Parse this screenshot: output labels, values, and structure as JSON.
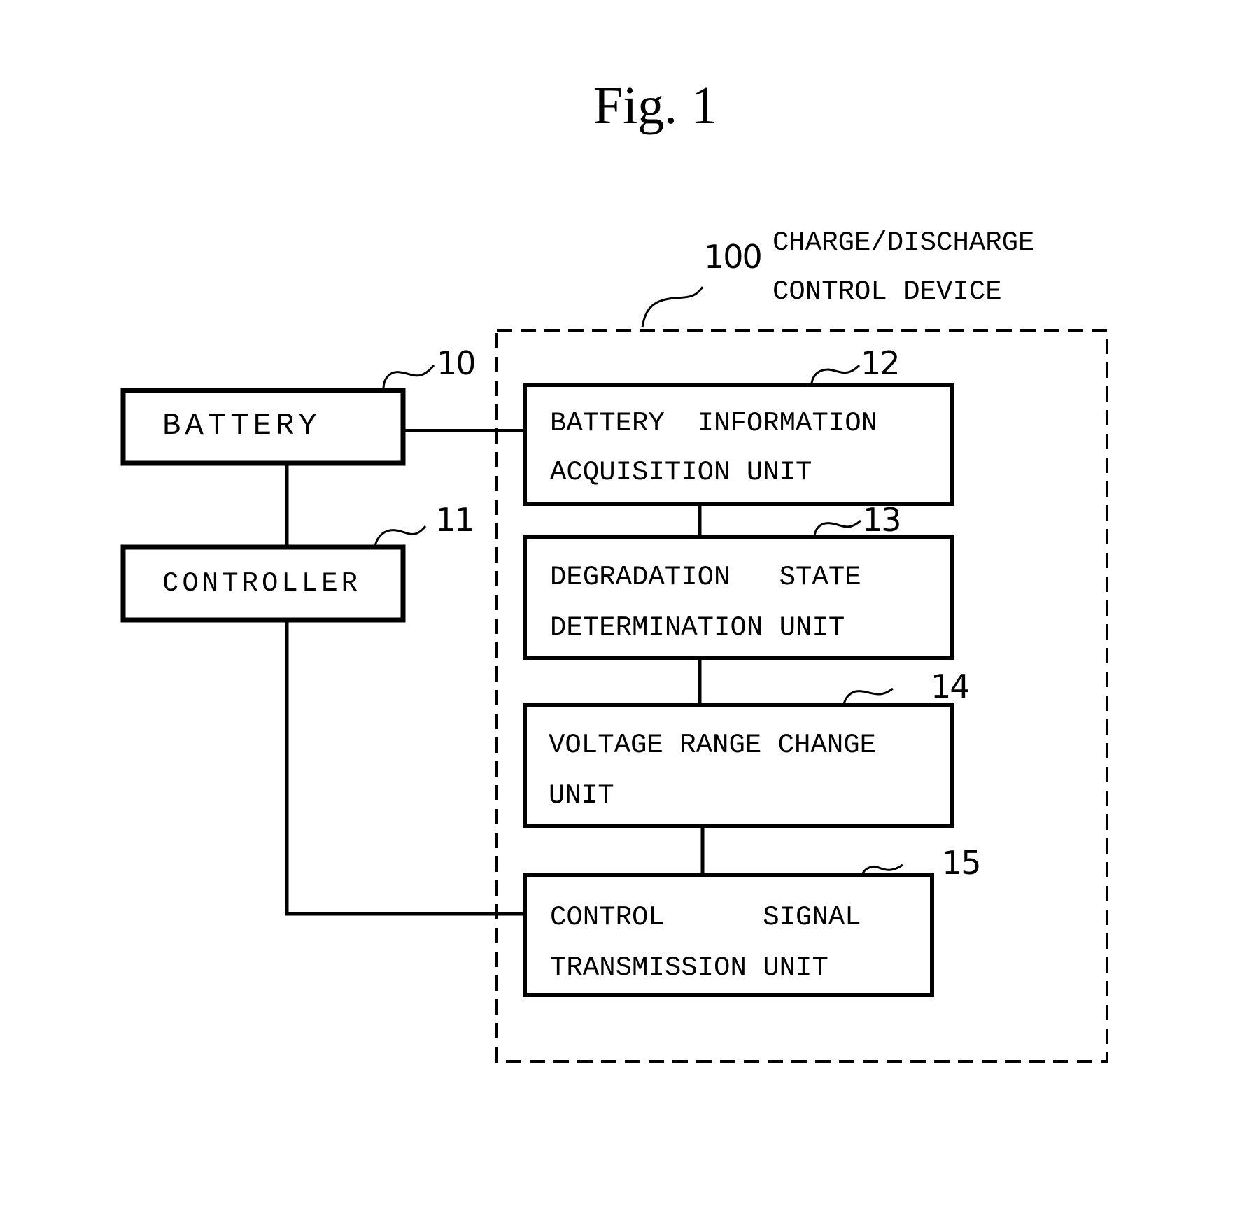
{
  "figure": {
    "title": "Fig. 1"
  },
  "device": {
    "ref": "100",
    "label_line1": "CHARGE/DISCHARGE",
    "label_line2": "CONTROL DEVICE"
  },
  "blocks": {
    "battery": {
      "ref": "10",
      "label": "BATTERY"
    },
    "controller": {
      "ref": "11",
      "label": "CONTROLLER"
    },
    "battery_info": {
      "ref": "12",
      "line1": "BATTERY  INFORMATION",
      "line2": "ACQUISITION UNIT"
    },
    "degradation": {
      "ref": "13",
      "line1": "DEGRADATION   STATE",
      "line2": "DETERMINATION UNIT"
    },
    "voltage_range": {
      "ref": "14",
      "line1": "VOLTAGE RANGE CHANGE",
      "line2": "UNIT"
    },
    "control_signal": {
      "ref": "15",
      "line1": "CONTROL      SIGNAL",
      "line2": "TRANSMISSION UNIT"
    }
  },
  "connections": [
    {
      "from": "battery",
      "to": "battery_info"
    },
    {
      "from": "battery",
      "to": "controller"
    },
    {
      "from": "controller",
      "to": "control_signal"
    },
    {
      "from": "battery_info",
      "to": "degradation"
    },
    {
      "from": "degradation",
      "to": "voltage_range"
    },
    {
      "from": "voltage_range",
      "to": "control_signal"
    }
  ]
}
